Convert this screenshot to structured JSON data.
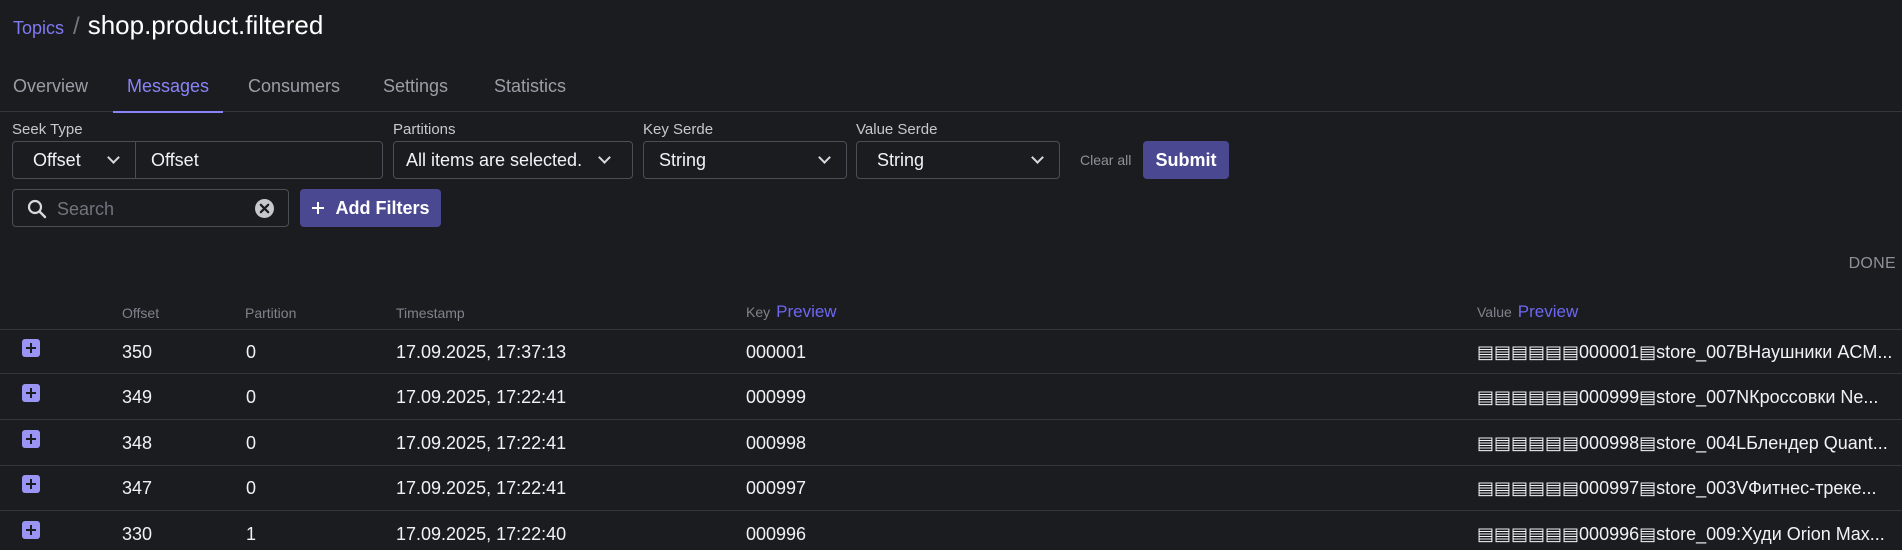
{
  "breadcrumb": {
    "parent": "Topics",
    "separator": "/",
    "title": "shop.product.filtered"
  },
  "tabs": [
    {
      "label": "Overview"
    },
    {
      "label": "Messages",
      "active": true
    },
    {
      "label": "Consumers"
    },
    {
      "label": "Settings"
    },
    {
      "label": "Statistics"
    }
  ],
  "filters": {
    "seek_type_label": "Seek Type",
    "seek_type_value": "Offset",
    "offset_value": "Offset",
    "partitions_label": "Partitions",
    "partitions_value": "All items are selected.",
    "key_serde_label": "Key Serde",
    "key_serde_value": "String",
    "value_serde_label": "Value Serde",
    "value_serde_value": "String",
    "clear_all": "Clear all",
    "submit": "Submit",
    "search_placeholder": "Search",
    "add_filters": "Add Filters"
  },
  "status": "DONE",
  "table": {
    "headers": {
      "offset": "Offset",
      "partition": "Partition",
      "timestamp": "Timestamp",
      "key": "Key",
      "key_preview": "Preview",
      "value": "Value",
      "value_preview": "Preview"
    },
    "rows": [
      {
        "offset": "350",
        "partition": "0",
        "timestamp": "17.09.2025, 17:37:13",
        "key": "000001",
        "value": "▤▤▤▤▤▤000001▤store_007BНаушники ACM..."
      },
      {
        "offset": "349",
        "partition": "0",
        "timestamp": "17.09.2025, 17:22:41",
        "key": "000999",
        "value": "▤▤▤▤▤▤000999▤store_007NКроссовки Ne..."
      },
      {
        "offset": "348",
        "partition": "0",
        "timestamp": "17.09.2025, 17:22:41",
        "key": "000998",
        "value": "▤▤▤▤▤▤000998▤store_004LБлендер Quant..."
      },
      {
        "offset": "347",
        "partition": "0",
        "timestamp": "17.09.2025, 17:22:41",
        "key": "000997",
        "value": "▤▤▤▤▤▤000997▤store_003VФитнес-треке..."
      },
      {
        "offset": "330",
        "partition": "1",
        "timestamp": "17.09.2025, 17:22:40",
        "key": "000996",
        "value": "▤▤▤▤▤▤000996▤store_009:Худи Orion Max..."
      }
    ]
  },
  "colors": {
    "background": "#1b1c20",
    "accent": "#8a84f8",
    "button": "#4a4890"
  }
}
